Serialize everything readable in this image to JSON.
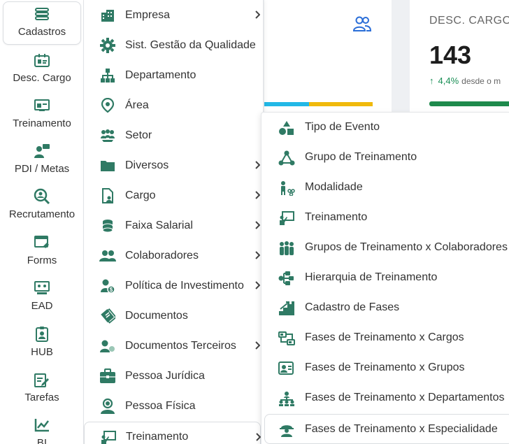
{
  "theme": {
    "accent": "#2f7a64",
    "blue": "#2a6ed8",
    "cyan": "#22b8e6",
    "yellow": "#f0b90b",
    "green": "#1e8a4c"
  },
  "rail": {
    "items": [
      {
        "label": "Cadastros",
        "icon": "list-icon"
      },
      {
        "label": "Desc. Cargo",
        "icon": "id-card-icon"
      },
      {
        "label": "Treinamento",
        "icon": "presentation-icon"
      },
      {
        "label": "PDI / Metas",
        "icon": "person-chat-icon"
      },
      {
        "label": "Recrutamento",
        "icon": "search-person-icon"
      },
      {
        "label": "Forms",
        "icon": "form-icon"
      },
      {
        "label": "EAD",
        "icon": "screen-class-icon"
      },
      {
        "label": "HUB",
        "icon": "badge-icon"
      },
      {
        "label": "Tarefas",
        "icon": "edit-task-icon"
      },
      {
        "label": "BI",
        "icon": "chart-icon"
      }
    ]
  },
  "dashboard": {
    "desc_card": {
      "title": "DESC. CARGO",
      "value": "143",
      "arrow": "↑",
      "change": "4,4%",
      "change_text": "desde o m"
    }
  },
  "menu1": {
    "items": [
      {
        "label": "Empresa",
        "icon": "building-icon",
        "has_submenu": true
      },
      {
        "label": "Sist. Gestão da Qualidade",
        "icon": "gear-icon",
        "has_submenu": false
      },
      {
        "label": "Departamento",
        "icon": "org-chart-icon",
        "has_submenu": false
      },
      {
        "label": "Área",
        "icon": "location-pin-icon",
        "has_submenu": false
      },
      {
        "label": "Setor",
        "icon": "team-icon",
        "has_submenu": false
      },
      {
        "label": "Diversos",
        "icon": "folder-icon",
        "has_submenu": true
      },
      {
        "label": "Cargo",
        "icon": "job-document-icon",
        "has_submenu": true
      },
      {
        "label": "Faixa Salarial",
        "icon": "coins-icon",
        "has_submenu": true
      },
      {
        "label": "Colaboradores",
        "icon": "users-icon",
        "has_submenu": true
      },
      {
        "label": "Política de Investimento",
        "icon": "investor-icon",
        "has_submenu": true
      },
      {
        "label": "Documentos",
        "icon": "documents-icon",
        "has_submenu": false
      },
      {
        "label": "Documentos Terceiros",
        "icon": "third-party-icon",
        "has_submenu": true
      },
      {
        "label": "Pessoa Jurídica",
        "icon": "briefcase-icon",
        "has_submenu": false
      },
      {
        "label": "Pessoa Física",
        "icon": "person-icon",
        "has_submenu": false
      },
      {
        "label": "Treinamento",
        "icon": "presentation-icon",
        "has_submenu": true
      }
    ]
  },
  "menu2": {
    "items": [
      {
        "label": "Tipo de Evento",
        "icon": "shapes-icon"
      },
      {
        "label": "Grupo de Treinamento",
        "icon": "group-network-icon"
      },
      {
        "label": "Modalidade",
        "icon": "modality-icon"
      },
      {
        "label": "Treinamento",
        "icon": "presentation-icon"
      },
      {
        "label": "Grupos de Treinamento x Colaboradores",
        "icon": "crowd-icon"
      },
      {
        "label": "Hierarquia de Treinamento",
        "icon": "hierarchy-icon"
      },
      {
        "label": "Cadastro de Fases",
        "icon": "stairs-icon"
      },
      {
        "label": "Fases de Treinamento x Cargos",
        "icon": "phase-cargo-icon"
      },
      {
        "label": "Fases de Treinamento x Grupos",
        "icon": "phase-group-icon"
      },
      {
        "label": "Fases de Treinamento x Departamentos",
        "icon": "phase-dept-icon"
      },
      {
        "label": "Fases de Treinamento x Especialidade",
        "icon": "specialist-icon"
      }
    ]
  }
}
